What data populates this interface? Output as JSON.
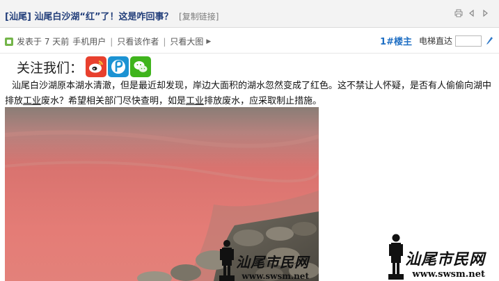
{
  "thread": {
    "tag": "[汕尾]",
    "title": "汕尾白沙湖“红”了！这是咋回事？",
    "copy_link": "[复制链接]"
  },
  "toolbar": {
    "icons": [
      "print-icon",
      "prev-icon",
      "next-icon"
    ]
  },
  "author_bar": {
    "posted": "发表于 7 天前",
    "device": "手机用户",
    "only_author": "只看该作者",
    "only_images": "只看大图",
    "floor": "1#楼主",
    "jump_label": "电梯直达",
    "jump_value": ""
  },
  "follow": {
    "label": "关注我们：",
    "icons": [
      "weibo-icon",
      "tencent-weibo-icon",
      "wechat-icon"
    ]
  },
  "post": {
    "p1": "汕尾白沙湖原本湖水清澈，但是最近却发现，岸边大面积的湖水忽然变成了红色。这不禁让人怀疑，是否有人偷偷向湖中排放",
    "u1": "工业",
    "p2": "废水？希望相关部门尽快查明，如是",
    "u2": "工业",
    "p3": "排放废水，应采取制止措施。"
  },
  "watermark": {
    "brand": "汕尾市民网",
    "url": "www.swsm.net"
  },
  "colors": {
    "title": "#223e7a",
    "floor": "#1f6fc4",
    "water_red": "#d9736f"
  }
}
